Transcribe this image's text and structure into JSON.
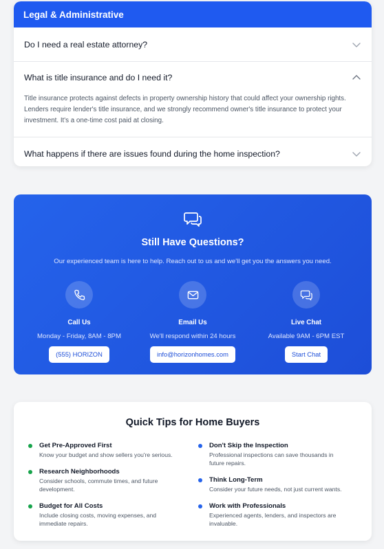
{
  "faq": {
    "section_title": "Legal & Administrative",
    "items": [
      {
        "question": "Do I need a real estate attorney?",
        "expanded": false
      },
      {
        "question": "What is title insurance and do I need it?",
        "expanded": true,
        "answer": "Title insurance protects against defects in property ownership history that could affect your ownership rights. Lenders require lender's title insurance, and we strongly recommend owner's title insurance to protect your investment. It's a one-time cost paid at closing."
      },
      {
        "question": "What happens if there are issues found during the home inspection?",
        "expanded": false
      }
    ]
  },
  "help": {
    "icon": "chat-bubbles-icon",
    "title": "Still Have Questions?",
    "subtitle": "Our experienced team is here to help. Reach out to us and we'll get you the answers you need.",
    "contacts": [
      {
        "icon": "phone-icon",
        "title": "Call Us",
        "desc": "Monday - Friday, 8AM - 8PM",
        "button": "(555) HORIZON"
      },
      {
        "icon": "mail-icon",
        "title": "Email Us",
        "desc": "We'll respond within 24 hours",
        "button": "info@horizonhomes.com"
      },
      {
        "icon": "chat-icon",
        "title": "Live Chat",
        "desc": "Available 9AM - 6PM EST",
        "button": "Start Chat"
      }
    ]
  },
  "tips": {
    "title": "Quick Tips for Home Buyers",
    "left": [
      {
        "title": "Get Pre-Approved First",
        "desc": "Know your budget and show sellers you're serious."
      },
      {
        "title": "Research Neighborhoods",
        "desc": "Consider schools, commute times, and future development."
      },
      {
        "title": "Budget for All Costs",
        "desc": "Include closing costs, moving expenses, and immediate repairs."
      }
    ],
    "right": [
      {
        "title": "Don't Skip the Inspection",
        "desc": "Professional inspections can save thousands in future repairs."
      },
      {
        "title": "Think Long-Term",
        "desc": "Consider your future needs, not just current wants."
      },
      {
        "title": "Work with Professionals",
        "desc": "Experienced agents, lenders, and inspectors are invaluable."
      }
    ]
  },
  "colors": {
    "primary": "#1f5af0",
    "tip_left_dot": "#16a34a",
    "tip_right_dot": "#2563eb"
  }
}
